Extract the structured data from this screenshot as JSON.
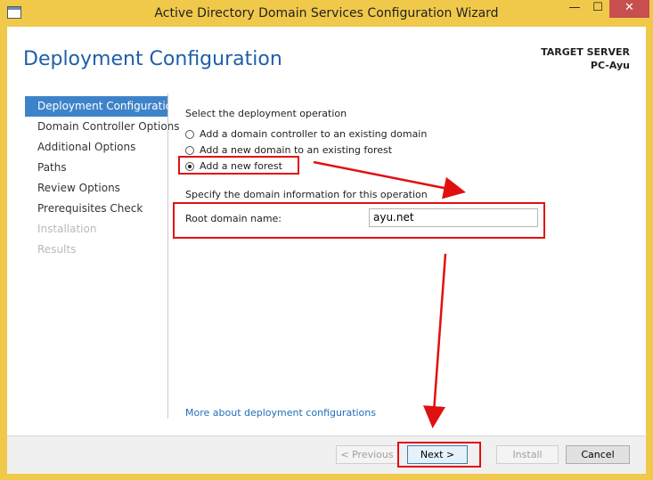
{
  "window": {
    "title": "Active Directory Domain Services Configuration Wizard",
    "minimize_glyph": "—",
    "maximize_glyph": "☐",
    "close_glyph": "✕"
  },
  "header": {
    "page_title": "Deployment Configuration",
    "target_label": "TARGET SERVER",
    "target_value": "PC-Ayu"
  },
  "nav": {
    "items": [
      {
        "label": "Deployment Configuration",
        "state": "active"
      },
      {
        "label": "Domain Controller Options",
        "state": "normal"
      },
      {
        "label": "Additional Options",
        "state": "normal"
      },
      {
        "label": "Paths",
        "state": "normal"
      },
      {
        "label": "Review Options",
        "state": "normal"
      },
      {
        "label": "Prerequisites Check",
        "state": "normal"
      },
      {
        "label": "Installation",
        "state": "disabled"
      },
      {
        "label": "Results",
        "state": "disabled"
      }
    ]
  },
  "main": {
    "operation_heading": "Select the deployment operation",
    "options": [
      {
        "label": "Add a domain controller to an existing domain",
        "checked": false
      },
      {
        "label": "Add a new domain to an existing forest",
        "checked": false
      },
      {
        "label": "Add a new forest",
        "checked": true
      }
    ],
    "domain_heading": "Specify the domain information for this operation",
    "root_domain_label": "Root domain name:",
    "root_domain_value": "ayu.net",
    "more_link": "More about deployment configurations"
  },
  "footer": {
    "previous": "< Previous",
    "next": "Next >",
    "install": "Install",
    "cancel": "Cancel"
  },
  "annotation_color": "#e01010",
  "accent_color": "#3e83c9"
}
